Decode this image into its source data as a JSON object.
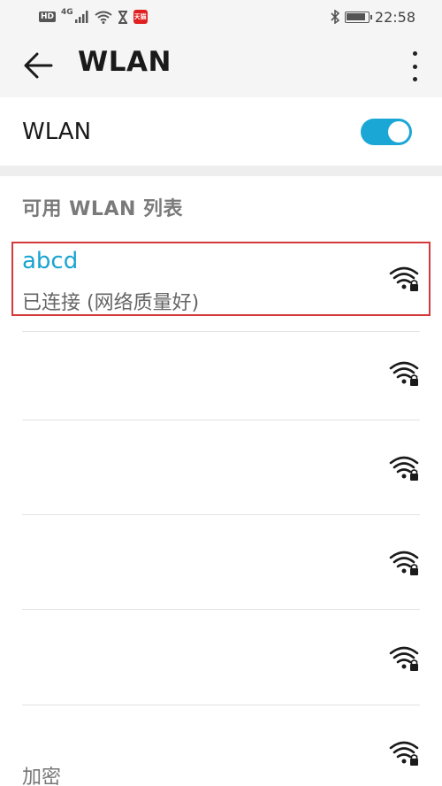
{
  "status_bar": {
    "hd": "HD",
    "network": "4G",
    "tmall": "天猫",
    "time": "22:58",
    "battery_level": 0.9
  },
  "app_bar": {
    "title": "WLAN"
  },
  "wlan_toggle": {
    "label": "WLAN",
    "enabled": true
  },
  "available_list": {
    "header": "可用 WLAN 列表",
    "networks": [
      {
        "name": "abcd",
        "status": "已连接 (网络质量好)",
        "secured": true
      },
      {
        "name": "",
        "status": "",
        "secured": true
      },
      {
        "name": "",
        "status": "",
        "secured": true
      },
      {
        "name": "",
        "status": "",
        "secured": true
      },
      {
        "name": "",
        "status": "",
        "secured": true
      },
      {
        "name": "",
        "status": "加密",
        "secured": true
      }
    ]
  },
  "colors": {
    "accent": "#1ba7d6",
    "connected_text": "#18a4d0",
    "highlight_border": "#d43a3a",
    "header_bg": "#f5f5f5"
  }
}
